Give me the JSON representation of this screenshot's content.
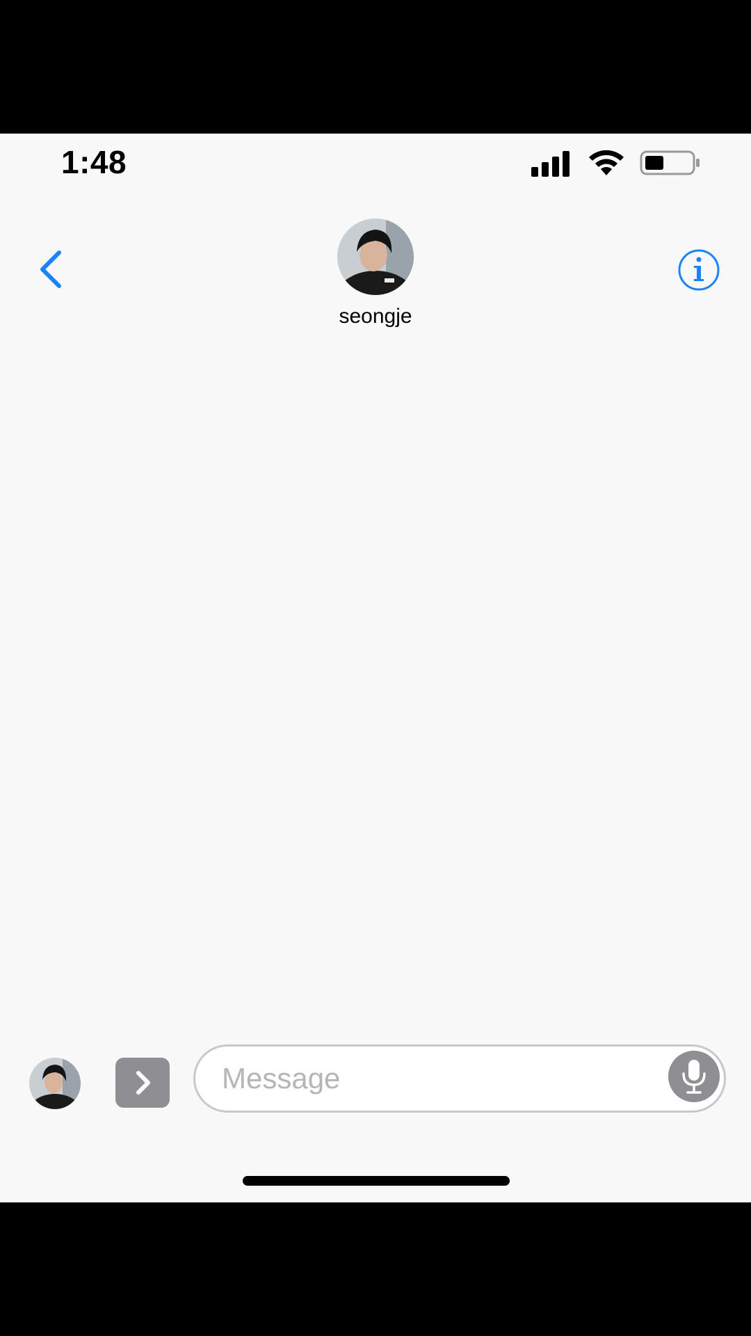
{
  "status_bar": {
    "time": "1:48"
  },
  "header": {
    "contact_name": "seongje",
    "back_icon": "chevron-left-icon",
    "info_icon": "info-circle-icon"
  },
  "composer": {
    "placeholder": "Message",
    "apps_icon": "chevron-right-icon",
    "mic_icon": "microphone-icon"
  },
  "colors": {
    "accent": "#1a82fb",
    "background": "#f8f8f8",
    "control_gray": "#8e8e93"
  }
}
